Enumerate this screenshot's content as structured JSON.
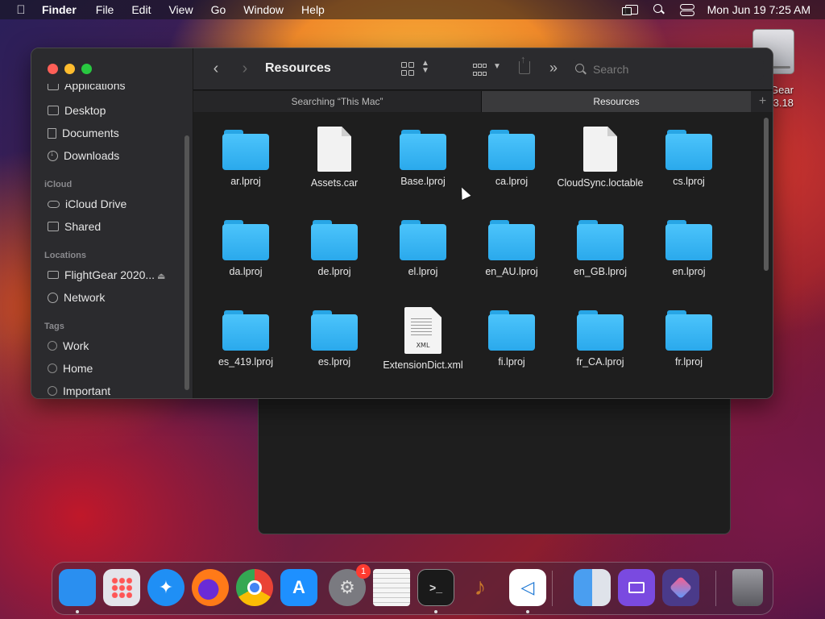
{
  "menubar": {
    "app_name": "Finder",
    "menus": [
      "File",
      "Edit",
      "View",
      "Go",
      "Window",
      "Help"
    ],
    "datetime": "Mon Jun 19  7:25 AM"
  },
  "desktop": {
    "disk_label_line1": "Gear",
    "disk_label_line2": ".3.18"
  },
  "finder": {
    "title": "Resources",
    "search_placeholder": "Search",
    "tabs": [
      {
        "label": "Searching “This Mac”",
        "active": false
      },
      {
        "label": "Resources",
        "active": true
      }
    ],
    "sidebar": {
      "partial_top": "Applications",
      "favorites": [
        {
          "label": "Desktop",
          "icon": "desktop-icon"
        },
        {
          "label": "Documents",
          "icon": "document-icon"
        },
        {
          "label": "Downloads",
          "icon": "downloads-icon"
        }
      ],
      "icloud_heading": "iCloud",
      "icloud": [
        {
          "label": "iCloud Drive",
          "icon": "cloud-icon"
        },
        {
          "label": "Shared",
          "icon": "shared-folder-icon"
        }
      ],
      "locations_heading": "Locations",
      "locations": [
        {
          "label": "FlightGear 2020...",
          "icon": "disk-icon"
        },
        {
          "label": "Network",
          "icon": "globe-icon"
        }
      ],
      "tags_heading": "Tags",
      "tags": [
        {
          "label": "Work"
        },
        {
          "label": "Home"
        },
        {
          "label": "Important"
        }
      ]
    },
    "files": [
      {
        "name": "ar.lproj",
        "kind": "folder"
      },
      {
        "name": "Assets.car",
        "kind": "file"
      },
      {
        "name": "Base.lproj",
        "kind": "folder"
      },
      {
        "name": "ca.lproj",
        "kind": "folder"
      },
      {
        "name": "CloudSync.loctable",
        "kind": "file"
      },
      {
        "name": "cs.lproj",
        "kind": "folder"
      },
      {
        "name": "da.lproj",
        "kind": "folder"
      },
      {
        "name": "de.lproj",
        "kind": "folder"
      },
      {
        "name": "el.lproj",
        "kind": "folder"
      },
      {
        "name": "en_AU.lproj",
        "kind": "folder"
      },
      {
        "name": "en_GB.lproj",
        "kind": "folder"
      },
      {
        "name": "en.lproj",
        "kind": "folder"
      },
      {
        "name": "es_419.lproj",
        "kind": "folder"
      },
      {
        "name": "es.lproj",
        "kind": "folder"
      },
      {
        "name": "ExtensionDict.xml",
        "kind": "xml"
      },
      {
        "name": "fi.lproj",
        "kind": "folder"
      },
      {
        "name": "fr_CA.lproj",
        "kind": "folder"
      },
      {
        "name": "fr.lproj",
        "kind": "folder"
      }
    ],
    "xml_badge": "XML"
  },
  "dock": {
    "apps": [
      {
        "name": "finder-icon",
        "running": true,
        "color": "#2a8ff0"
      },
      {
        "name": "launchpad-icon",
        "running": false,
        "color": "#d8d8dc"
      },
      {
        "name": "safari-icon",
        "running": false,
        "color": "#1f8ff5"
      },
      {
        "name": "firefox-icon",
        "running": false,
        "color": "#ff7a18"
      },
      {
        "name": "chrome-icon",
        "running": false,
        "color": "#ffffff"
      },
      {
        "name": "app-store-icon",
        "running": false,
        "color": "#1e90ff"
      },
      {
        "name": "system-settings-icon",
        "running": false,
        "color": "#7a7a80",
        "badge": "1"
      },
      {
        "name": "textedit-icon",
        "running": false,
        "color": "#f2f2f2"
      },
      {
        "name": "terminal-icon",
        "running": true,
        "color": "#1a1a1a"
      },
      {
        "name": "garageband-icon",
        "running": false,
        "color": "#6a3a1a"
      },
      {
        "name": "vscode-icon",
        "running": true,
        "color": "#ffffff"
      },
      {
        "name": "migration-assistant-icon",
        "running": false,
        "color": "#9aa4b4"
      },
      {
        "name": "podcast-capture-icon",
        "running": false,
        "color": "#7a4ae0"
      },
      {
        "name": "shortcuts-icon",
        "running": false,
        "color": "#4a3a8a"
      },
      {
        "name": "trash-icon",
        "running": false,
        "color": "#6e6e72"
      }
    ]
  }
}
